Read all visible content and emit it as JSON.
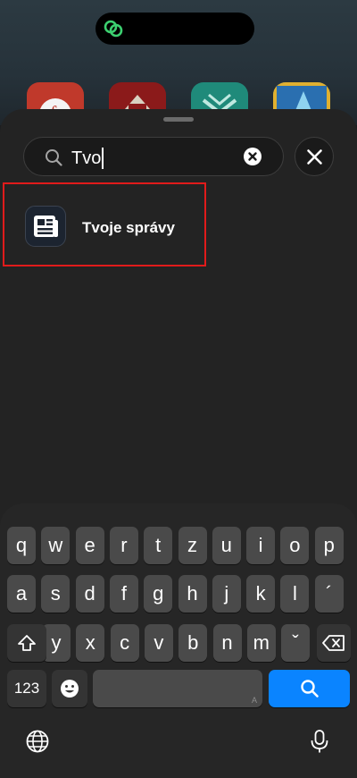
{
  "search": {
    "query": "Tvo"
  },
  "result": {
    "label": "Tvoje správy",
    "icon": "newspaper-icon"
  },
  "keyboard": {
    "row1": [
      "q",
      "w",
      "e",
      "r",
      "t",
      "z",
      "u",
      "i",
      "o",
      "p"
    ],
    "row2": [
      "a",
      "s",
      "d",
      "f",
      "g",
      "h",
      "j",
      "k",
      "l",
      "´"
    ],
    "row3": [
      "y",
      "x",
      "c",
      "v",
      "b",
      "n",
      "m",
      "ˇ"
    ],
    "numbers_label": "123",
    "space_indicator": "A"
  },
  "colors": {
    "accent_blue": "#0a84ff",
    "highlight_red": "#e01b1b",
    "link_green": "#3cd070"
  }
}
